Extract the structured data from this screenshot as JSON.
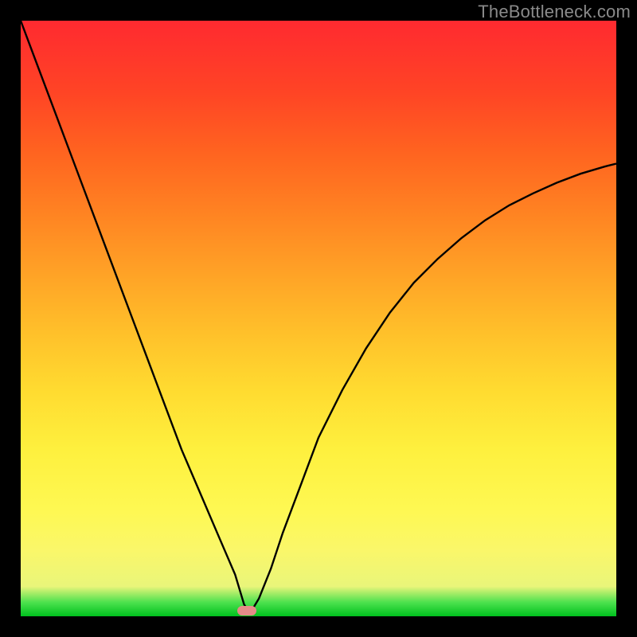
{
  "watermark": "TheBottleneck.com",
  "chart_data": {
    "type": "line",
    "title": "",
    "xlabel": "",
    "ylabel": "",
    "xlim": [
      0,
      100
    ],
    "ylim": [
      0,
      100
    ],
    "grid": false,
    "legend": false,
    "series": [
      {
        "name": "bottleneck-curve",
        "x": [
          0,
          3,
          6,
          9,
          12,
          15,
          18,
          21,
          24,
          27,
          30,
          33,
          36,
          37.5,
          38.5,
          40,
          42,
          44,
          47,
          50,
          54,
          58,
          62,
          66,
          70,
          74,
          78,
          82,
          86,
          90,
          94,
          98,
          100
        ],
        "y": [
          100,
          92,
          84,
          76,
          68,
          60,
          52,
          44,
          36,
          28,
          21,
          14,
          7,
          2,
          0.5,
          3,
          8,
          14,
          22,
          30,
          38,
          45,
          51,
          56,
          60,
          63.5,
          66.5,
          69,
          71,
          72.8,
          74.3,
          75.5,
          76
        ]
      }
    ],
    "annotations": [
      {
        "name": "optimal-marker",
        "x": 38,
        "y": 1
      }
    ],
    "background_gradient": {
      "stops": [
        {
          "pos": 0.0,
          "color": "#00c11e"
        },
        {
          "pos": 0.024,
          "color": "#4fe24f"
        },
        {
          "pos": 0.05,
          "color": "#e9f57a"
        },
        {
          "pos": 0.11,
          "color": "#faf76a"
        },
        {
          "pos": 0.18,
          "color": "#fef852"
        },
        {
          "pos": 0.28,
          "color": "#fef03e"
        },
        {
          "pos": 0.38,
          "color": "#ffdb30"
        },
        {
          "pos": 0.48,
          "color": "#ffbf2a"
        },
        {
          "pos": 0.58,
          "color": "#ffa126"
        },
        {
          "pos": 0.68,
          "color": "#ff8222"
        },
        {
          "pos": 0.78,
          "color": "#ff6320"
        },
        {
          "pos": 0.88,
          "color": "#ff4425"
        },
        {
          "pos": 1.0,
          "color": "#ff2a30"
        }
      ]
    }
  }
}
